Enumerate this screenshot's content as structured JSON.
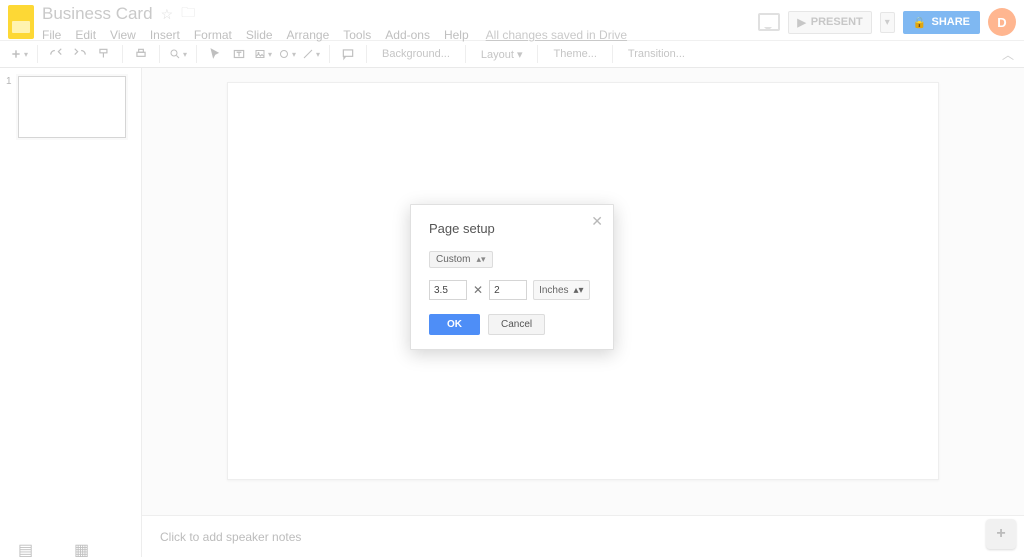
{
  "header": {
    "doc_title": "Business Card",
    "menus": [
      "File",
      "Edit",
      "View",
      "Insert",
      "Format",
      "Slide",
      "Arrange",
      "Tools",
      "Add-ons",
      "Help"
    ],
    "save_status": "All changes saved in Drive",
    "present_label": "PRESENT",
    "share_label": "SHARE",
    "avatar_initial": "D"
  },
  "toolbar": {
    "background_label": "Background...",
    "layout_label": "Layout",
    "theme_label": "Theme...",
    "transition_label": "Transition..."
  },
  "film_strip": {
    "slide_number": "1"
  },
  "notes": {
    "placeholder": "Click to add speaker notes"
  },
  "explore": {
    "glyph": "+"
  },
  "dialog": {
    "title": "Page setup",
    "size_mode": "Custom",
    "width": "3.5",
    "height": "2",
    "unit": "Inches",
    "ok_label": "OK",
    "cancel_label": "Cancel"
  }
}
